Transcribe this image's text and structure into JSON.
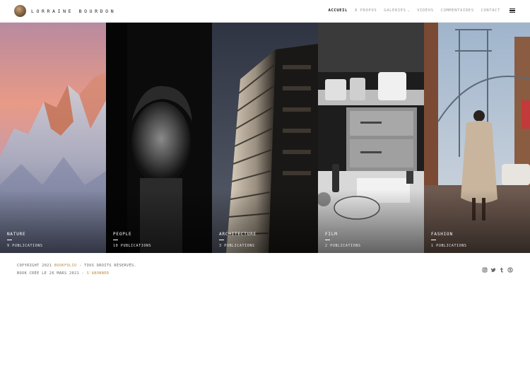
{
  "site": {
    "title": "LORRAINE BOURDON"
  },
  "nav": [
    {
      "label": "ACCUEIL",
      "active": true
    },
    {
      "label": "À PROPOS",
      "active": false
    },
    {
      "label": "GALERIES",
      "active": false,
      "dropdown": true
    },
    {
      "label": "VIDÉOS",
      "active": false
    },
    {
      "label": "COMMENTAIRES",
      "active": false
    },
    {
      "label": "CONTACT",
      "active": false
    }
  ],
  "galleries": [
    {
      "name": "NATURE",
      "count": "9 PUBLICATIONS"
    },
    {
      "name": "PEOPLE",
      "count": "10 PUBLICATIONS"
    },
    {
      "name": "ARCHITECTURE",
      "count": "3 PUBLICATIONS"
    },
    {
      "name": "FILM",
      "count": "2 PUBLICATIONS"
    },
    {
      "name": "FASHION",
      "count": "1 PUBLICATIONS"
    }
  ],
  "footer": {
    "copyright_prefix": "COPYRIGHT 2021",
    "brand": "BOOKFOLIO",
    "copyright_suffix": "- TOUS DROITS RÉSERVÉS.",
    "created": "BOOK CRÉE LE 26 MARS 2021 -",
    "subscribe": "S'ABONNER"
  },
  "social": [
    "instagram-icon",
    "twitter-icon",
    "tumblr-icon",
    "skype-icon"
  ],
  "colors": {
    "accent": "#b98e3f",
    "text": "#222222",
    "nav_inactive": "#9a9a9a"
  }
}
